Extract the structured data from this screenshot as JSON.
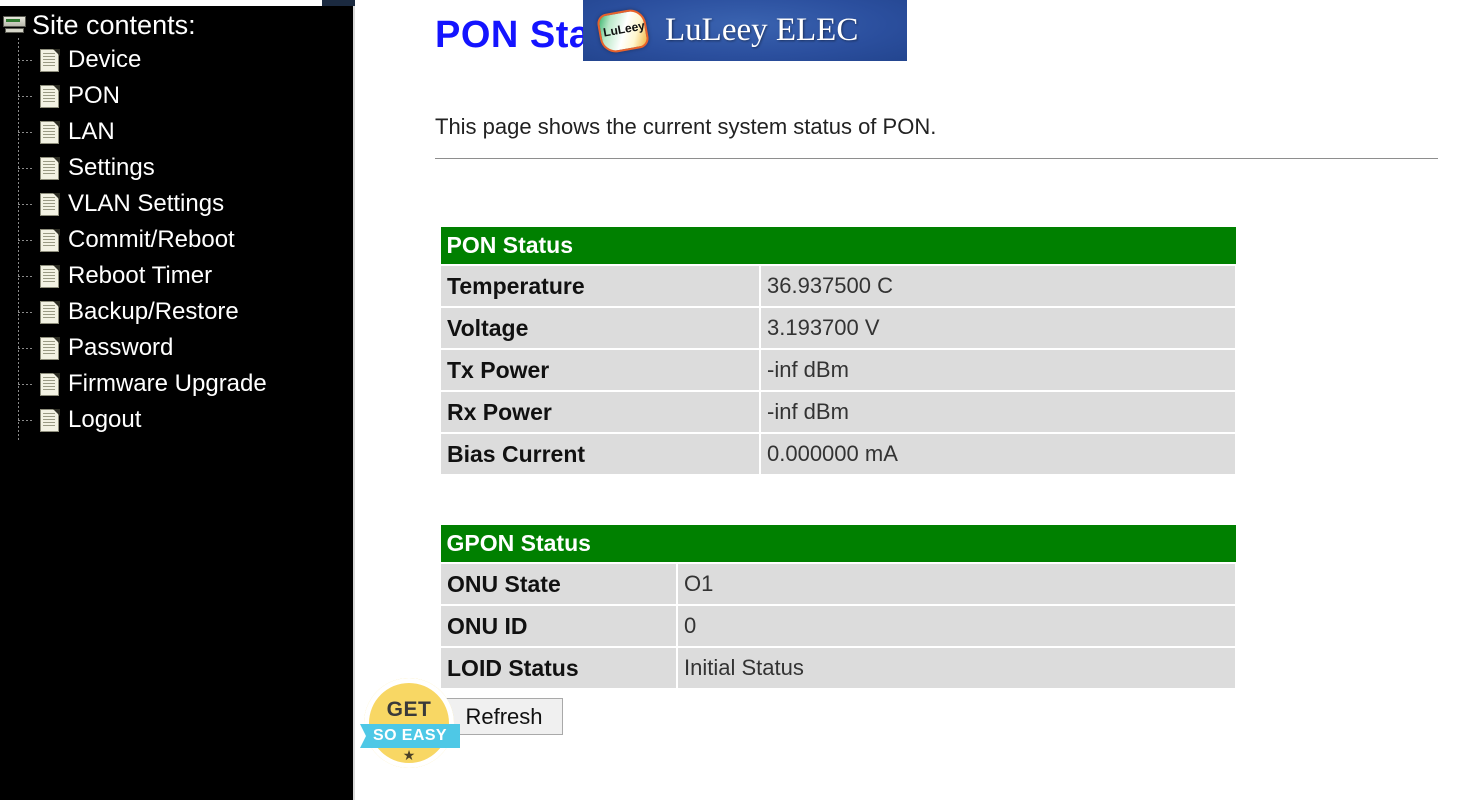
{
  "sidebar": {
    "root_label": "Site contents:",
    "root_icon": "monitor-icon",
    "item_icon": "document-icon",
    "items": [
      {
        "label": "Device"
      },
      {
        "label": "PON"
      },
      {
        "label": "LAN"
      },
      {
        "label": "Settings"
      },
      {
        "label": "VLAN Settings"
      },
      {
        "label": "Commit/Reboot"
      },
      {
        "label": "Reboot Timer"
      },
      {
        "label": "Backup/Restore"
      },
      {
        "label": "Password"
      },
      {
        "label": "Firmware Upgrade"
      },
      {
        "label": "Logout"
      }
    ]
  },
  "main": {
    "title": "PON Status",
    "description": "This page shows the current system status of PON.",
    "refresh_label": "Refresh"
  },
  "pon_status": {
    "header": "PON Status",
    "rows": [
      {
        "key": "Temperature",
        "value": "36.937500 C"
      },
      {
        "key": "Voltage",
        "value": "3.193700 V"
      },
      {
        "key": "Tx Power",
        "value": "-inf dBm"
      },
      {
        "key": "Rx Power",
        "value": "-inf dBm"
      },
      {
        "key": "Bias Current",
        "value": "0.000000 mA"
      }
    ]
  },
  "gpon_status": {
    "header": "GPON Status",
    "rows": [
      {
        "key": "ONU State",
        "value": "O1"
      },
      {
        "key": "ONU ID",
        "value": "0"
      },
      {
        "key": "LOID Status",
        "value": "Initial Status"
      }
    ]
  },
  "watermarks": {
    "banner": {
      "logo_text": "LuLeey",
      "text": "LuLeey ELEC"
    },
    "badge": {
      "top_text": "GET",
      "ribbon_text": "SO EASY",
      "star_glyph": "★"
    }
  },
  "colors": {
    "table_header_green": "#008000",
    "table_cell_gray": "#dcdcdc",
    "title_blue": "#1414ff",
    "sidebar_black": "#000000",
    "badge_yellow": "#f8d764",
    "ribbon_cyan": "#4ec8e6",
    "banner_blue": "#2b4f9e"
  }
}
